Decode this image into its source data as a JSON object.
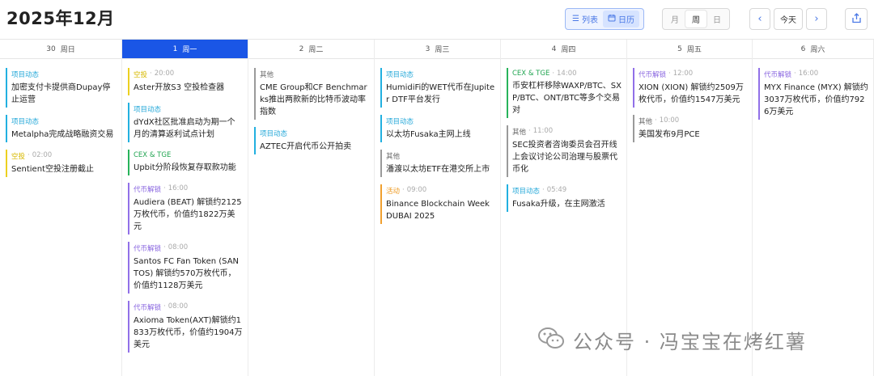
{
  "header": {
    "title": "2025年12月",
    "view_toggle": [
      {
        "label": "列表"
      },
      {
        "label": "日历"
      }
    ],
    "range_toggle": [
      "月",
      "周",
      "日"
    ],
    "today_label": "今天",
    "prev_glyph": "‹",
    "next_glyph": "›"
  },
  "columns": [
    {
      "date": "30",
      "weekday": "周日",
      "events": [
        {
          "tag": "项目动态",
          "time": "",
          "type": "xm",
          "text": "加密支付卡提供商Dupay停止运营"
        },
        {
          "tag": "项目动态",
          "time": "",
          "type": "xm",
          "text": "Metalpha完成战略融资交易"
        },
        {
          "tag": "空投",
          "time": "02:00",
          "type": "kt",
          "text": "Sentient空投注册截止"
        }
      ]
    },
    {
      "date": "1",
      "weekday": "周一",
      "today": true,
      "events": [
        {
          "tag": "空投",
          "time": "20:00",
          "type": "kt",
          "text": "Aster开放S3 空投检查器"
        },
        {
          "tag": "项目动态",
          "time": "",
          "type": "xm",
          "text": "dYdX社区批准启动为期一个月的清算返利试点计划"
        },
        {
          "tag": "CEX & TGE",
          "time": "",
          "type": "cex",
          "text": "Upbit分阶段恢复存取款功能"
        },
        {
          "tag": "代币解锁",
          "time": "16:00",
          "type": "js",
          "text": "Audiera (BEAT) 解锁约2125万枚代币，价值约1822万美元"
        },
        {
          "tag": "代币解锁",
          "time": "08:00",
          "type": "js",
          "text": "Santos FC Fan Token (SANTOS) 解锁约570万枚代币，价值约1128万美元"
        },
        {
          "tag": "代币解锁",
          "time": "08:00",
          "type": "js",
          "text": "Axioma Token(AXT)解锁约1833万枚代币，价值约1904万美元"
        }
      ]
    },
    {
      "date": "2",
      "weekday": "周二",
      "events": [
        {
          "tag": "其他",
          "time": "",
          "type": "qt",
          "text": "CME Group和CF Benchmarks推出两款新的比特币波动率指数"
        },
        {
          "tag": "项目动态",
          "time": "",
          "type": "xm",
          "text": "AZTEC开启代币公开拍卖"
        }
      ]
    },
    {
      "date": "3",
      "weekday": "周三",
      "events": [
        {
          "tag": "项目动态",
          "time": "",
          "type": "xm",
          "text": "HumidiFi的WET代币在Jupiter DTF平台发行"
        },
        {
          "tag": "项目动态",
          "time": "",
          "type": "xm",
          "text": "以太坊Fusaka主网上线"
        },
        {
          "tag": "其他",
          "time": "",
          "type": "qt",
          "text": "潘渡以太坊ETF在港交所上市"
        },
        {
          "tag": "活动",
          "time": "09:00",
          "type": "hd",
          "text": "Binance Blockchain Week DUBAI 2025"
        }
      ]
    },
    {
      "date": "4",
      "weekday": "周四",
      "events": [
        {
          "tag": "CEX & TGE",
          "time": "14:00",
          "type": "cex",
          "text": "币安杠杆移除WAXP/BTC、SXP/BTC、ONT/BTC等多个交易对"
        },
        {
          "tag": "其他",
          "time": "11:00",
          "type": "qt",
          "text": "SEC投资者咨询委员会召开线上会议讨论公司治理与股票代币化"
        },
        {
          "tag": "项目动态",
          "time": "05:49",
          "type": "xm",
          "text": "Fusaka升级，在主网激活"
        }
      ]
    },
    {
      "date": "5",
      "weekday": "周五",
      "events": [
        {
          "tag": "代币解锁",
          "time": "12:00",
          "type": "js",
          "text": "XION (XION) 解锁约2509万枚代币，价值约1547万美元"
        },
        {
          "tag": "其他",
          "time": "10:00",
          "type": "qt",
          "text": "美国发布9月PCE"
        }
      ]
    },
    {
      "date": "6",
      "weekday": "周六",
      "events": [
        {
          "tag": "代币解锁",
          "time": "16:00",
          "type": "js",
          "text": "MYX Finance (MYX) 解锁约3037万枚代币，价值约7926万美元"
        }
      ]
    }
  ],
  "watermark": {
    "text": "公众号 · 冯宝宝在烤红薯"
  },
  "colors": {
    "accent": "#1a56e6",
    "project": "#22b0e0",
    "airdrop": "#ecd020",
    "cex": "#27b35a",
    "unlock": "#9170e8",
    "other": "#9a9a9a",
    "event": "#f0a030"
  }
}
